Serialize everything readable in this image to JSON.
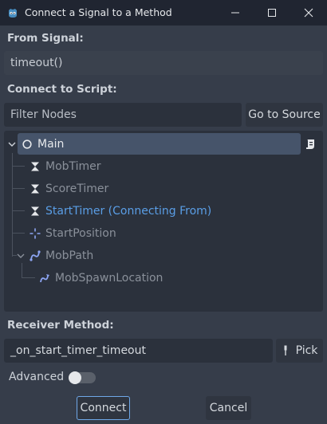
{
  "window": {
    "title": "Connect a Signal to a Method"
  },
  "from_signal": {
    "label": "From Signal:",
    "value": "timeout()"
  },
  "connect_to_script": {
    "label": "Connect to Script:",
    "filter_placeholder": "Filter Nodes",
    "goto_source_label": "Go to Source"
  },
  "tree": {
    "nodes": [
      {
        "name": "Main",
        "icon": "node-circle-icon",
        "state": "selected"
      },
      {
        "name": "MobTimer",
        "icon": "timer-icon",
        "state": "disabled"
      },
      {
        "name": "ScoreTimer",
        "icon": "timer-icon",
        "state": "disabled"
      },
      {
        "name": "StartTimer (Connecting From)",
        "icon": "timer-icon",
        "state": "source"
      },
      {
        "name": "StartPosition",
        "icon": "marker-icon",
        "state": "disabled"
      },
      {
        "name": "MobPath",
        "icon": "path-icon",
        "state": "disabled"
      },
      {
        "name": "MobSpawnLocation",
        "icon": "path-follow-icon",
        "state": "disabled"
      }
    ]
  },
  "receiver": {
    "label": "Receiver Method:",
    "value": "_on_start_timer_timeout",
    "pick_label": "Pick"
  },
  "advanced": {
    "label": "Advanced",
    "enabled": false
  },
  "buttons": {
    "connect_label": "Connect",
    "cancel_label": "Cancel"
  },
  "colors": {
    "accent": "#5a9ee6",
    "background": "#363d4a",
    "titlebar": "#202531",
    "selected_row": "#46546a"
  }
}
